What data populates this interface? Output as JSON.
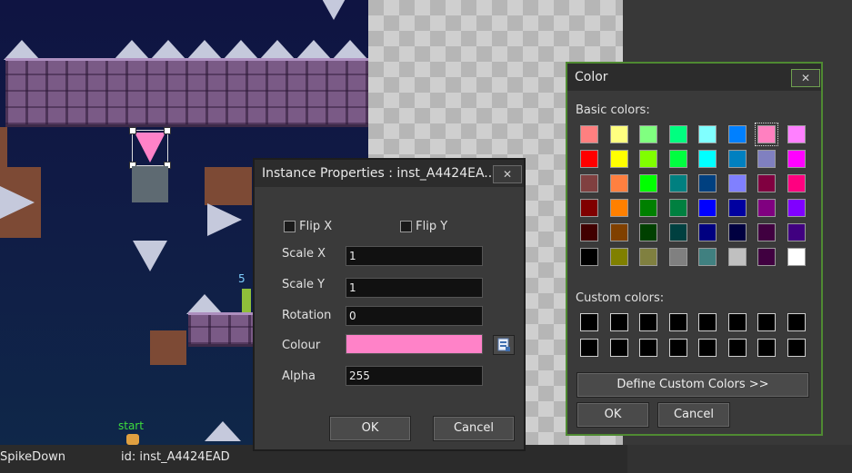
{
  "room": {
    "start_label": "start",
    "badge_text": "5"
  },
  "statusbar": {
    "object_name": "SpikeDown",
    "instance_id": "id: inst_A4424EAD"
  },
  "instance_dialog": {
    "title": "Instance Properties : inst_A4424EA...",
    "close_glyph": "✕",
    "flip_x_label": "Flip X",
    "flip_y_label": "Flip Y",
    "flip_x": false,
    "flip_y": false,
    "scale_x_label": "Scale X",
    "scale_x": "1",
    "scale_y_label": "Scale Y",
    "scale_y": "1",
    "rotation_label": "Rotation",
    "rotation": "0",
    "colour_label": "Colour",
    "colour_value": "#ff82c8",
    "alpha_label": "Alpha",
    "alpha": "255",
    "ok_label": "OK",
    "cancel_label": "Cancel",
    "picker_icon": "color-picker-icon"
  },
  "color_dialog": {
    "title": "Color",
    "close_glyph": "✕",
    "basic_label": "Basic colors:",
    "custom_label": "Custom colors:",
    "define_label": "Define Custom Colors >>",
    "ok_label": "OK",
    "cancel_label": "Cancel",
    "selected_index": 6,
    "basic_colors": [
      "#ff8080",
      "#ffff80",
      "#80ff80",
      "#00ff80",
      "#80ffff",
      "#0080ff",
      "#ff80c0",
      "#ff80ff",
      "#ff0000",
      "#ffff00",
      "#80ff00",
      "#00ff40",
      "#00ffff",
      "#0080c0",
      "#8080c0",
      "#ff00ff",
      "#804040",
      "#ff8040",
      "#00ff00",
      "#008080",
      "#004080",
      "#8080ff",
      "#800040",
      "#ff0080",
      "#800000",
      "#ff8000",
      "#008000",
      "#008040",
      "#0000ff",
      "#0000a0",
      "#800080",
      "#8000ff",
      "#400000",
      "#804000",
      "#004000",
      "#004040",
      "#000080",
      "#000040",
      "#400040",
      "#400080",
      "#000000",
      "#808000",
      "#808040",
      "#808080",
      "#408080",
      "#c0c0c0",
      "#400040",
      "#ffffff"
    ],
    "custom_colors": [
      "#000000",
      "#000000",
      "#000000",
      "#000000",
      "#000000",
      "#000000",
      "#000000",
      "#000000",
      "#000000",
      "#000000",
      "#000000",
      "#000000",
      "#000000",
      "#000000",
      "#000000",
      "#000000"
    ]
  }
}
